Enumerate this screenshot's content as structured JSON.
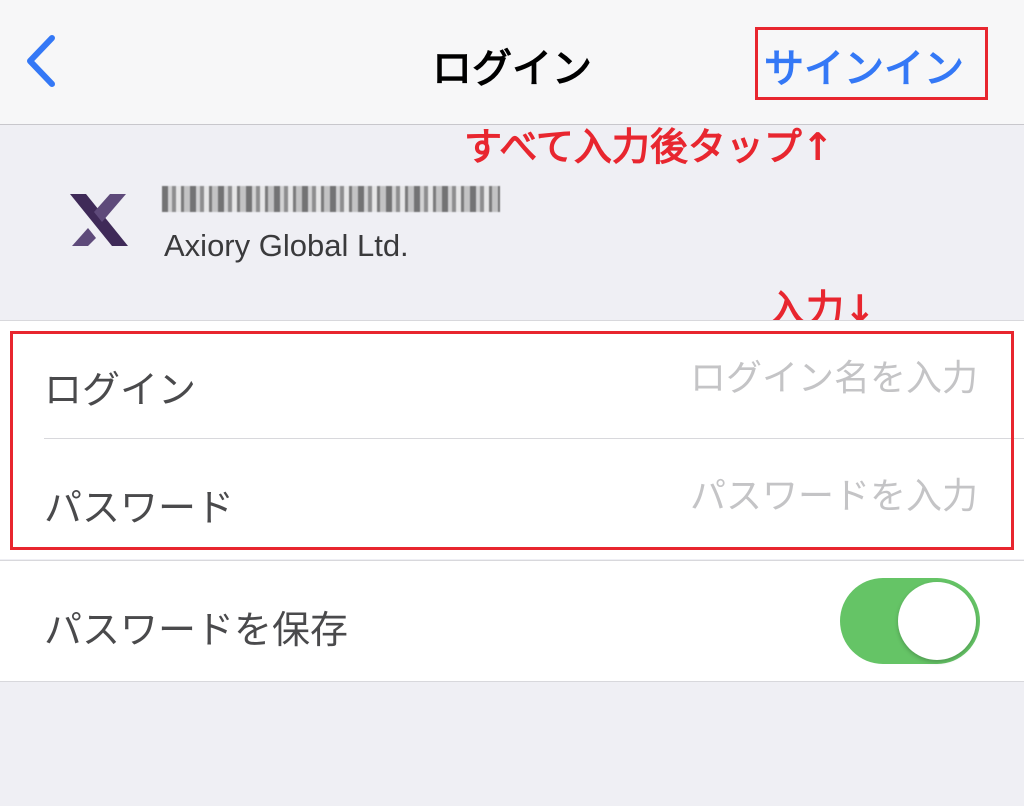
{
  "navbar": {
    "title": "ログイン",
    "signin_label": "サインイン"
  },
  "annotations": {
    "top": "すべて入力後タップ↑",
    "middle": "入力↓"
  },
  "server": {
    "company": "Axiory Global Ltd."
  },
  "form": {
    "login_label": "ログイン",
    "login_placeholder": "ログイン名を入力",
    "password_label": "パスワード",
    "password_placeholder": "パスワードを入力",
    "save_password_label": "パスワードを保存",
    "save_password_on": true
  },
  "colors": {
    "accent": "#3478f6",
    "annotation": "#e8262f",
    "toggle_on": "#65c466",
    "logo": "#3f2a58"
  }
}
